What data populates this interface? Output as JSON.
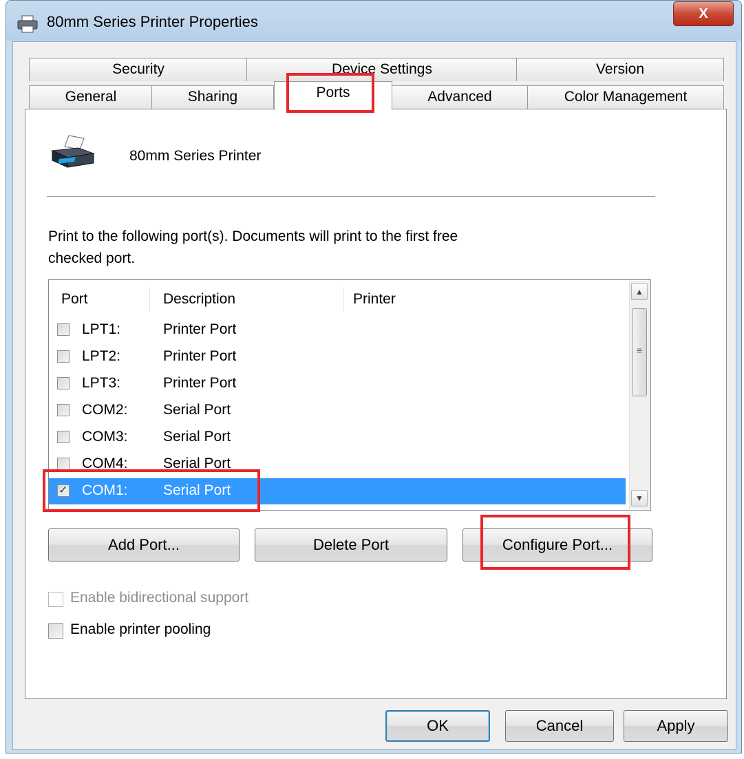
{
  "window": {
    "title": "80mm Series Printer Properties",
    "close_label": "X"
  },
  "tabs": {
    "row1": [
      "Security",
      "Device Settings",
      "Version"
    ],
    "row2": [
      "General",
      "Sharing",
      "Ports",
      "Advanced",
      "Color Management"
    ],
    "active": "Ports"
  },
  "printer_name": "80mm Series Printer",
  "instructions": {
    "line1": "Print to the following port(s). Documents will print to the first free",
    "line2": "checked port."
  },
  "ports_table": {
    "headers": [
      "Port",
      "Description",
      "Printer"
    ],
    "rows": [
      {
        "port": "LPT1:",
        "description": "Printer Port",
        "printer": "",
        "checked": false,
        "selected": false
      },
      {
        "port": "LPT2:",
        "description": "Printer Port",
        "printer": "",
        "checked": false,
        "selected": false
      },
      {
        "port": "LPT3:",
        "description": "Printer Port",
        "printer": "",
        "checked": false,
        "selected": false
      },
      {
        "port": "COM2:",
        "description": "Serial Port",
        "printer": "",
        "checked": false,
        "selected": false
      },
      {
        "port": "COM3:",
        "description": "Serial Port",
        "printer": "",
        "checked": false,
        "selected": false
      },
      {
        "port": "COM4:",
        "description": "Serial Port",
        "printer": "",
        "checked": false,
        "selected": false
      },
      {
        "port": "COM1:",
        "description": "Serial Port",
        "printer": "",
        "checked": true,
        "selected": true
      }
    ]
  },
  "buttons": {
    "add_port": "Add Port...",
    "delete_port": "Delete Port",
    "configure_port": "Configure Port...",
    "ok": "OK",
    "cancel": "Cancel",
    "apply": "Apply"
  },
  "options": {
    "bidirectional": {
      "label": "Enable bidirectional support",
      "checked": false,
      "enabled": false
    },
    "pooling": {
      "label": "Enable printer pooling",
      "checked": false,
      "enabled": true
    }
  },
  "colors": {
    "selection": "#3399ff",
    "highlight_box": "#e8262b"
  },
  "icons": {
    "app": "printer-icon",
    "printer": "printer-icon",
    "checkmark": "✓"
  }
}
